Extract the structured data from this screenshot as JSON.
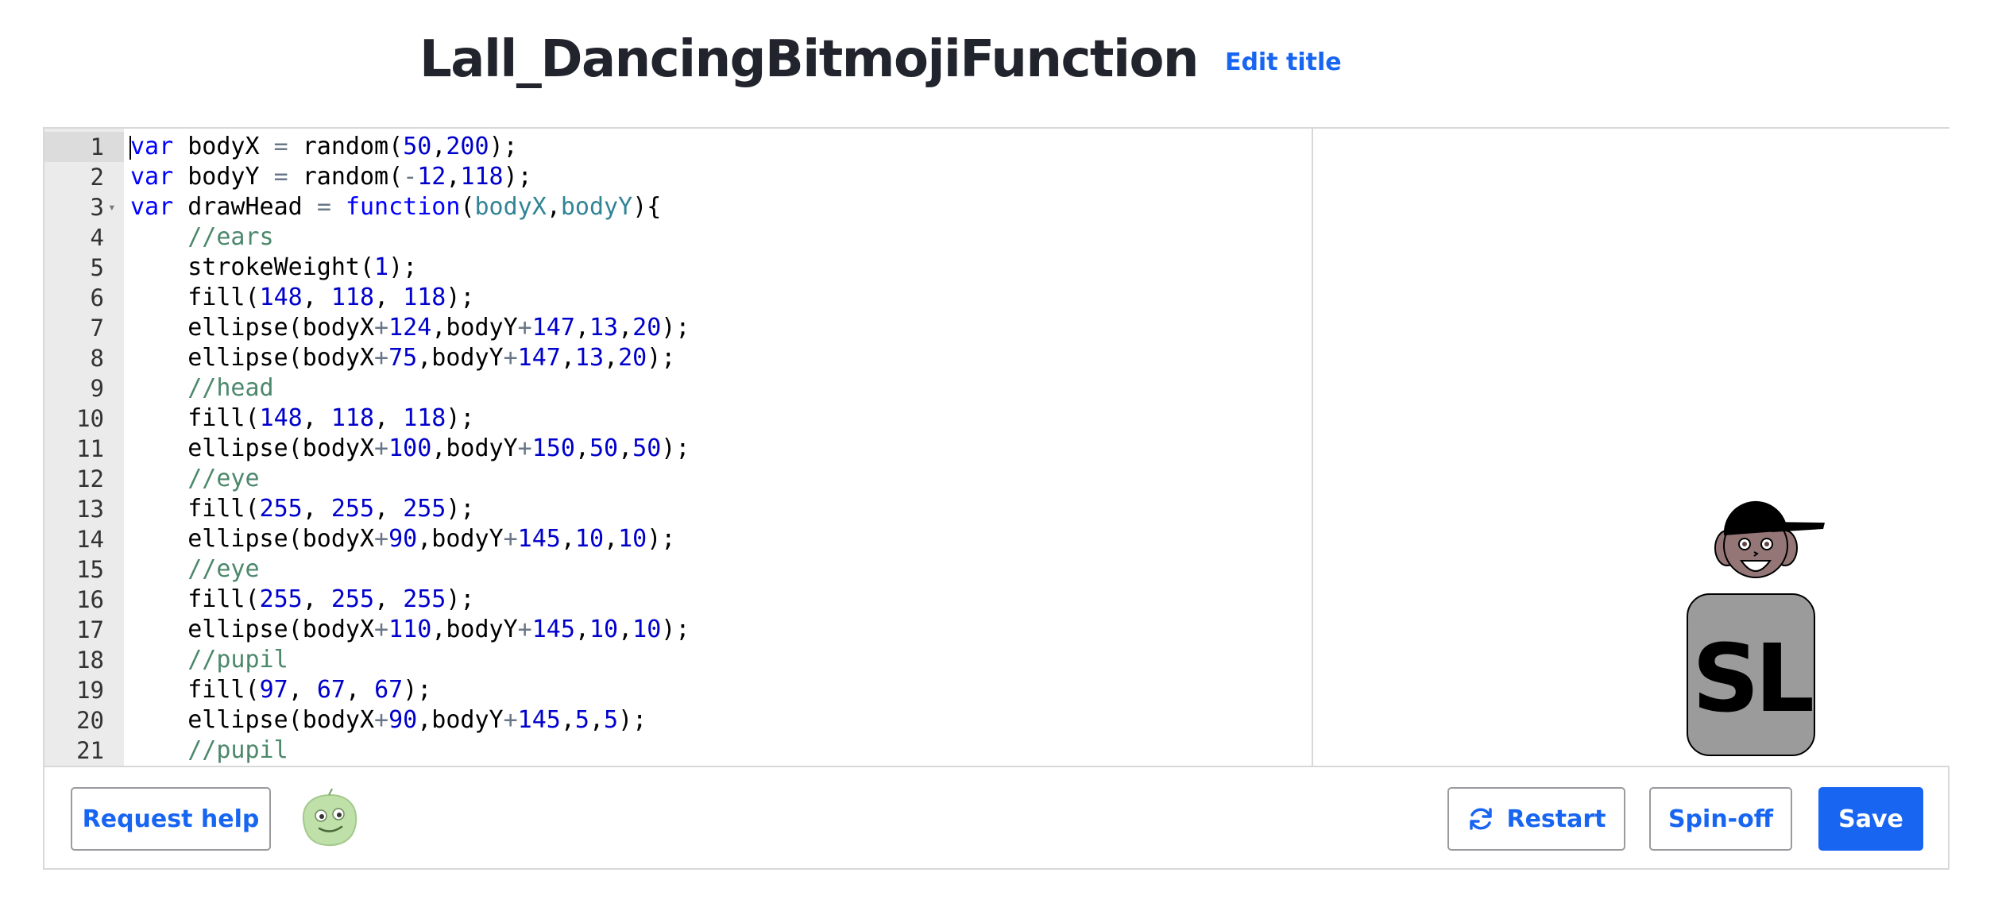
{
  "header": {
    "title": "Lall_DancingBitmojiFunction",
    "edit_title_label": "Edit title"
  },
  "editor": {
    "lines": [
      {
        "n": "1",
        "text": "var bodyX = random(50,200);"
      },
      {
        "n": "2",
        "text": "var bodyY = random(-12,118);"
      },
      {
        "n": "3",
        "text": "var drawHead = function(bodyX,bodyY){"
      },
      {
        "n": "4",
        "text": "    //ears"
      },
      {
        "n": "5",
        "text": "    strokeWeight(1);"
      },
      {
        "n": "6",
        "text": "    fill(148, 118, 118);"
      },
      {
        "n": "7",
        "text": "    ellipse(bodyX+124,bodyY+147,13,20);"
      },
      {
        "n": "8",
        "text": "    ellipse(bodyX+75,bodyY+147,13,20);"
      },
      {
        "n": "9",
        "text": "    //head"
      },
      {
        "n": "10",
        "text": "    fill(148, 118, 118);"
      },
      {
        "n": "11",
        "text": "    ellipse(bodyX+100,bodyY+150,50,50);"
      },
      {
        "n": "12",
        "text": "    //eye"
      },
      {
        "n": "13",
        "text": "    fill(255, 255, 255);"
      },
      {
        "n": "14",
        "text": "    ellipse(bodyX+90,bodyY+145,10,10);"
      },
      {
        "n": "15",
        "text": "    //eye"
      },
      {
        "n": "16",
        "text": "    fill(255, 255, 255);"
      },
      {
        "n": "17",
        "text": "    ellipse(bodyX+110,bodyY+145,10,10);"
      },
      {
        "n": "18",
        "text": "    //pupil"
      },
      {
        "n": "19",
        "text": "    fill(97, 67, 67);"
      },
      {
        "n": "20",
        "text": "    ellipse(bodyX+90,bodyY+145,5,5);"
      },
      {
        "n": "21",
        "text": "    //pupil"
      }
    ]
  },
  "canvas": {
    "shirt_text": "SL"
  },
  "footer": {
    "request_help_label": "Request help",
    "restart_label": "Restart",
    "spinoff_label": "Spin-off",
    "save_label": "Save"
  },
  "colors": {
    "accent": "#1865f2",
    "skin": "#947676",
    "shirt": "#9b9b9b",
    "gutter": "#ebebeb"
  },
  "icons": [
    "restart-icon",
    "avatar-icon",
    "fold-arrow-icon"
  ]
}
